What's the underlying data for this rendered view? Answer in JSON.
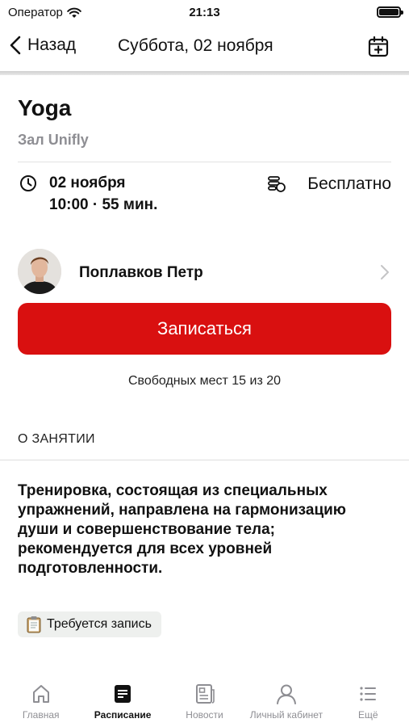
{
  "status_bar": {
    "carrier": "Оператор",
    "time": "21:13"
  },
  "nav": {
    "back_label": "Назад",
    "title": "Суббота, 02 ноября"
  },
  "event": {
    "title": "Yoga",
    "hall": "Зал Unifly",
    "date": "02 ноября",
    "time_duration": "10:00 · 55 мин.",
    "price": "Бесплатно"
  },
  "trainer": {
    "name": "Поплавков Петр"
  },
  "signup": {
    "button_label": "Записаться",
    "seats_text": "Свободных мест 15 из 20"
  },
  "about": {
    "heading": "О ЗАНЯТИИ",
    "description": "Тренировка, состоящая из специальных упражнений, направлена на гармонизацию души и совершенствование тела; рекомендуется для всех уровней подготовленности.",
    "tag": "Требуется запись"
  },
  "tabs": [
    {
      "label": "Главная",
      "icon": "home-icon"
    },
    {
      "label": "Расписание",
      "icon": "schedule-icon",
      "active": true
    },
    {
      "label": "Новости",
      "icon": "news-icon"
    },
    {
      "label": "Личный кабинет",
      "icon": "profile-icon"
    },
    {
      "label": "Ещё",
      "icon": "more-list-icon"
    }
  ],
  "colors": {
    "accent": "#d91010",
    "secondary_text": "#8e8e93"
  }
}
